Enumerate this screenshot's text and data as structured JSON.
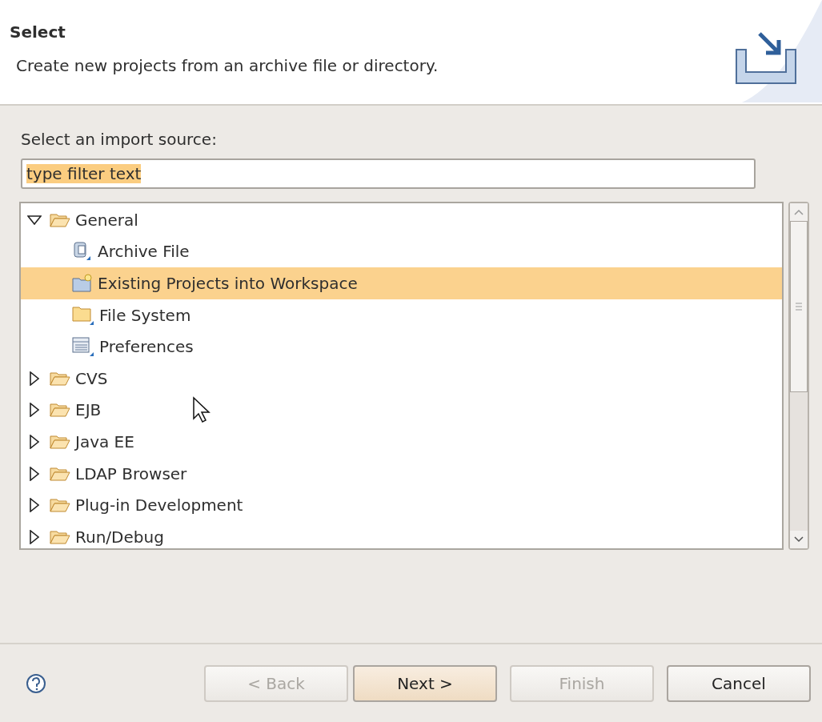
{
  "header": {
    "title": "Select",
    "description": "Create new projects from an archive file or directory."
  },
  "source_label": "Select an import source:",
  "filter": {
    "value": "type filter text",
    "value_selected": true
  },
  "tree": [
    {
      "label": "General",
      "kind": "folder",
      "expanded": true,
      "selected": false,
      "children": [
        {
          "label": "Archive File",
          "kind": "archive",
          "selected": false
        },
        {
          "label": "Existing Projects into Workspace",
          "kind": "project",
          "selected": true
        },
        {
          "label": "File System",
          "kind": "filesystem",
          "selected": false
        },
        {
          "label": "Preferences",
          "kind": "preferences",
          "selected": false
        }
      ]
    },
    {
      "label": "CVS",
      "kind": "folder",
      "expanded": false,
      "selected": false
    },
    {
      "label": "EJB",
      "kind": "folder",
      "expanded": false,
      "selected": false
    },
    {
      "label": "Java EE",
      "kind": "folder",
      "expanded": false,
      "selected": false
    },
    {
      "label": "LDAP Browser",
      "kind": "folder",
      "expanded": false,
      "selected": false
    },
    {
      "label": "Plug-in Development",
      "kind": "folder",
      "expanded": false,
      "selected": false
    },
    {
      "label": "Run/Debug",
      "kind": "folder",
      "expanded": false,
      "selected": false
    }
  ],
  "buttons": [
    {
      "label": "< Back",
      "disabled": true,
      "default": false
    },
    {
      "label": "Next >",
      "disabled": false,
      "default": true
    },
    {
      "label": "Finish",
      "disabled": true,
      "default": false
    },
    {
      "label": "Cancel",
      "disabled": false,
      "default": false
    }
  ]
}
